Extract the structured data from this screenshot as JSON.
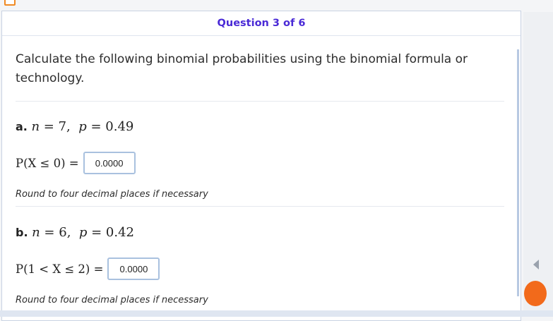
{
  "header": {
    "question_label": "Question 3 of 6"
  },
  "instructions": "Calculate the following binomial probabilities using the binomial formula or technology.",
  "parts": [
    {
      "label": "a.",
      "params": {
        "n": "7",
        "p": "0.49"
      },
      "prob_lhs": "P(X ≤ 0) =",
      "answer": "0.0000",
      "hint": "Round to four decimal places if necessary"
    },
    {
      "label": "b.",
      "params": {
        "n": "6",
        "p": "0.42"
      },
      "prob_lhs": "P(1 < X ≤ 2) =",
      "answer": "0.0000",
      "hint": "Round to four decimal places if necessary"
    }
  ],
  "colors": {
    "accent": "#4a2ad6",
    "answer_border": "#a9c1df",
    "orange": "#f26a1b"
  }
}
